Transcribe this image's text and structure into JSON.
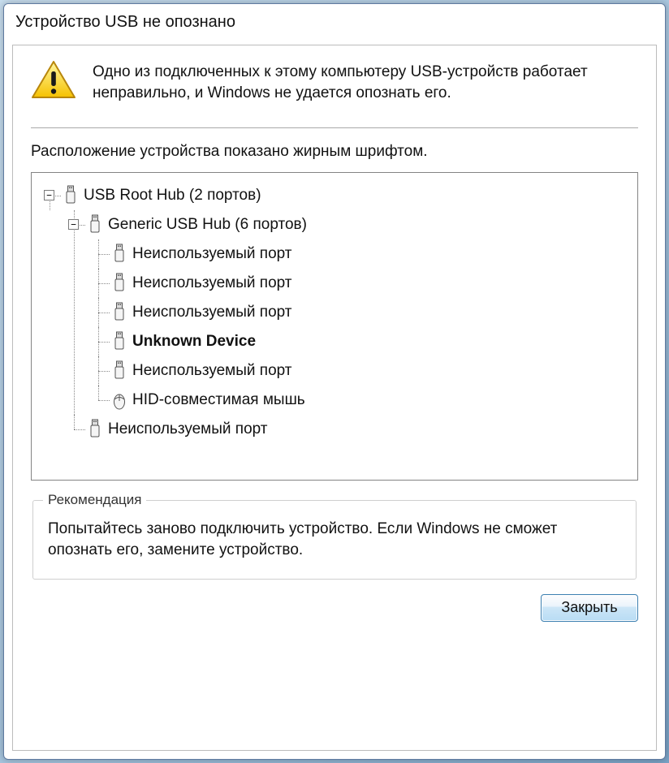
{
  "window": {
    "title": "Устройство USB не опознано"
  },
  "message": "Одно из подключенных к этому компьютеру USB-устройств работает неправильно, и Windows не удается опознать его.",
  "location_label": "Расположение устройства показано жирным шрифтом.",
  "tree": {
    "root": {
      "label": "USB Root Hub (2 портов)",
      "icon": "usb",
      "expanded": true,
      "children": [
        {
          "label": "Generic USB Hub (6 портов)",
          "icon": "usb",
          "expanded": true,
          "children": [
            {
              "label": "Неиспользуемый порт",
              "icon": "usb"
            },
            {
              "label": "Неиспользуемый порт",
              "icon": "usb"
            },
            {
              "label": "Неиспользуемый порт",
              "icon": "usb"
            },
            {
              "label": "Unknown Device",
              "icon": "usb",
              "bold": true
            },
            {
              "label": "Неиспользуемый порт",
              "icon": "usb"
            },
            {
              "label": "HID-совместимая мышь",
              "icon": "mouse"
            }
          ]
        },
        {
          "label": "Неиспользуемый порт",
          "icon": "usb"
        }
      ]
    }
  },
  "recommendation": {
    "title": "Рекомендация",
    "body": "Попытайтесь заново подключить устройство. Если Windows не сможет опознать его, замените устройство."
  },
  "buttons": {
    "close": "Закрыть"
  }
}
